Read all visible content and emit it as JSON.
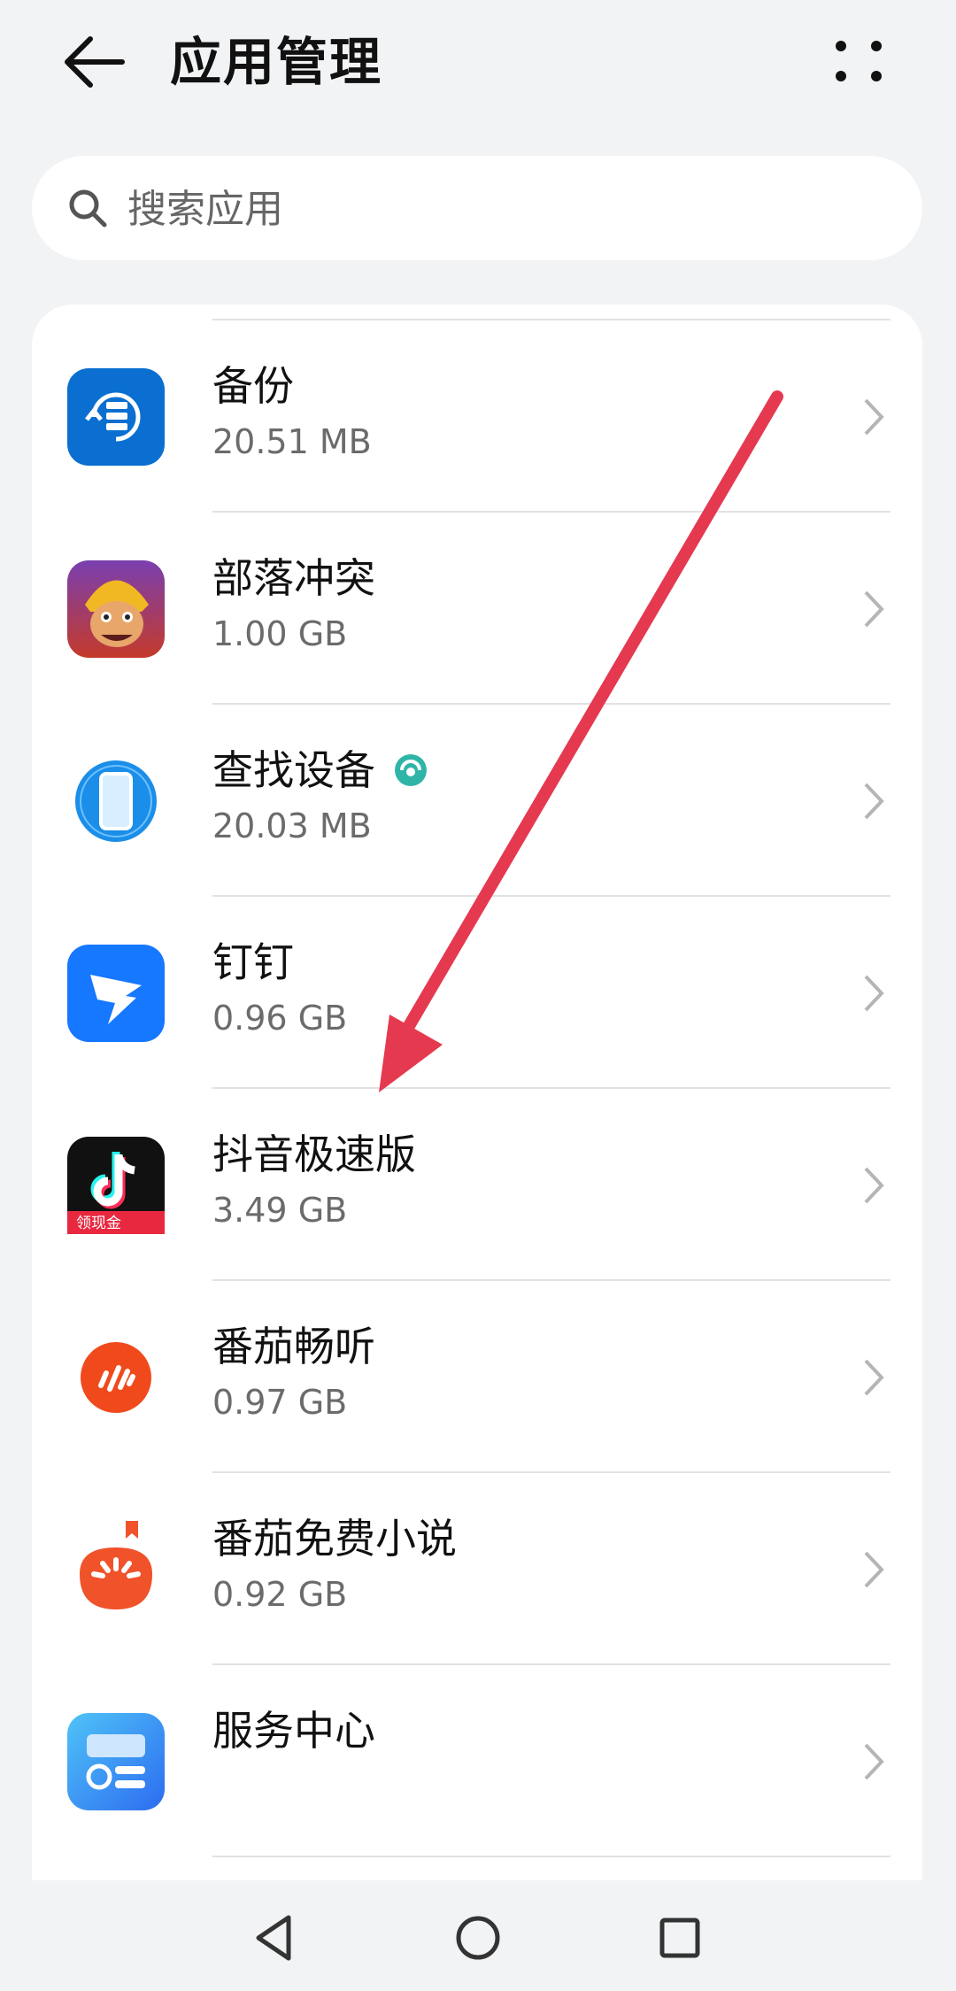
{
  "header": {
    "title": "应用管理",
    "back_icon": "arrow-left-icon",
    "more_icon": "more-dots-icon"
  },
  "search": {
    "placeholder": "搜索应用",
    "icon": "search-icon"
  },
  "apps": [
    {
      "name": "备份",
      "size": "20.51 MB",
      "icon": "backup-app-icon",
      "color": "#0a6fd1"
    },
    {
      "name": "部落冲突",
      "size": "1.00 GB",
      "icon": "clash-of-clans-app-icon",
      "color": "#7a3fb0"
    },
    {
      "name": "查找设备",
      "size": "20.03 MB",
      "icon": "find-device-app-icon",
      "color": "#1a8ee8",
      "badge": "security-badge-icon"
    },
    {
      "name": "钉钉",
      "size": "0.96 GB",
      "icon": "dingtalk-app-icon",
      "color": "#1677ff"
    },
    {
      "name": "抖音极速版",
      "size": "3.49 GB",
      "icon": "douyin-lite-app-icon",
      "color": "#111111",
      "icon_text": "领现金"
    },
    {
      "name": "番茄畅听",
      "size": "0.97 GB",
      "icon": "fanqie-listen-app-icon",
      "color": "#f04a1c"
    },
    {
      "name": "番茄免费小说",
      "size": "0.92 GB",
      "icon": "fanqie-novel-app-icon",
      "color": "#f0522a"
    },
    {
      "name": "服务中心",
      "size": "",
      "icon": "service-center-app-icon",
      "color": "#2d8cf0"
    }
  ],
  "annotation": {
    "type": "arrow",
    "color": "#e53950"
  },
  "navbar": {
    "back": "nav-back-icon",
    "home": "nav-home-icon",
    "recents": "nav-recents-icon"
  }
}
